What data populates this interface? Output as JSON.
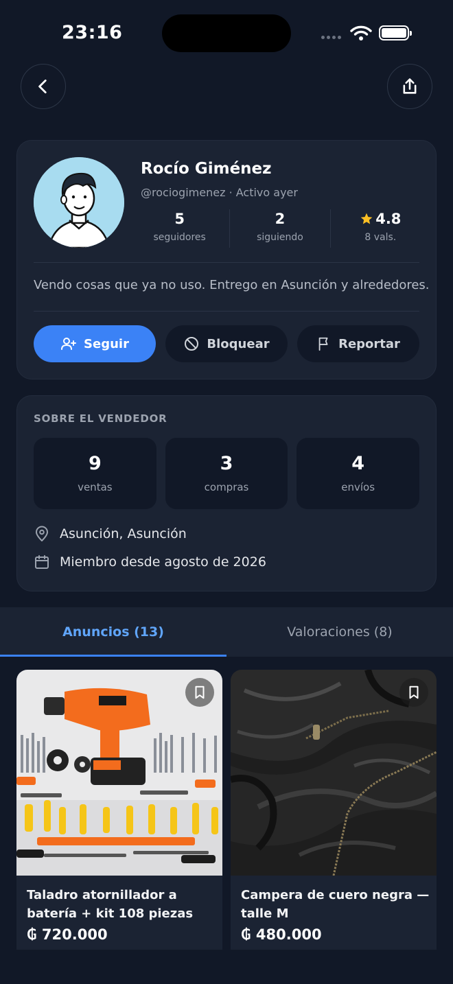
{
  "status_bar": {
    "time": "23:16"
  },
  "profile": {
    "name": "Rocío Giménez",
    "handle": "@rociogimenez",
    "separator": "·",
    "activity": "Activo ayer",
    "stats": [
      {
        "value": "5",
        "label": "seguidores"
      },
      {
        "value": "2",
        "label": "siguiendo"
      },
      {
        "value": "4.8",
        "label": "8 vals.",
        "icon": "star-icon"
      }
    ],
    "bio": "Vendo cosas que ya no uso. Entrego en Asunción y alrededores.",
    "buttons": {
      "follow": "Seguir",
      "block": "Bloquear",
      "report": "Reportar"
    }
  },
  "about": {
    "title": "SOBRE EL VENDEDOR",
    "tiles": [
      {
        "value": "9",
        "label": "ventas"
      },
      {
        "value": "3",
        "label": "compras"
      },
      {
        "value": "4",
        "label": "envíos"
      }
    ],
    "location": "Asunción, Asunción",
    "member_since": "Miembro desde agosto de 2026"
  },
  "tabs": [
    {
      "label": "Anuncios (13)",
      "active": true
    },
    {
      "label": "Valoraciones (8)",
      "active": false
    }
  ],
  "listings": [
    {
      "title": "Taladro atornillador a batería + kit 108 piezas",
      "price": "₲ 720.000"
    },
    {
      "title": "Campera de cuero negra — talle M",
      "price": "₲ 480.000"
    }
  ],
  "colors": {
    "background": "#111827",
    "card": "#1b2333",
    "accent": "#3b82f6",
    "star": "#fbbf24"
  }
}
